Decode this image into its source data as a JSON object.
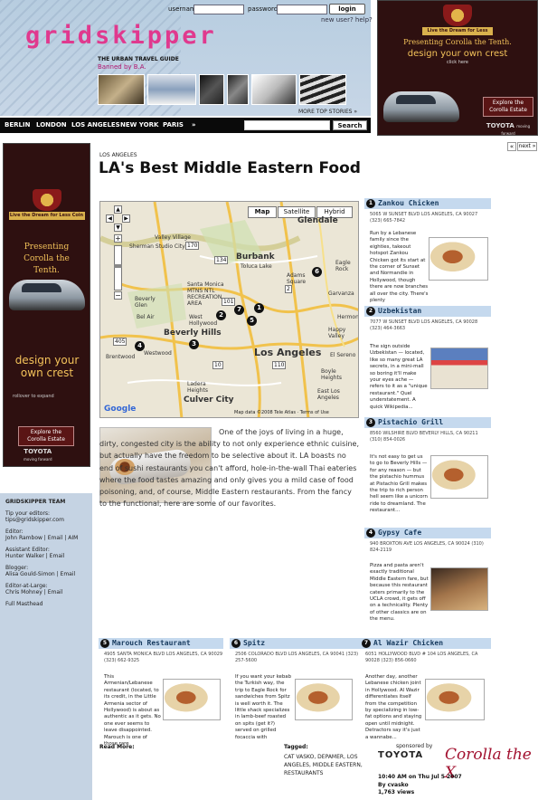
{
  "header": {
    "logo": "gridskipper",
    "username_label": "username:",
    "password_label": "password:",
    "login_button": "login",
    "new_user": "new user? help?",
    "tagline": "THE URBAN TRAVEL GUIDE",
    "banned": "Banned by B.A.",
    "more_stories": "MORE TOP STORIES »"
  },
  "nav": {
    "items": [
      "BERLIN",
      "LONDON",
      "LOS ANGELES",
      "NEW YORK",
      "PARIS",
      "»"
    ],
    "search_button": "Search"
  },
  "ad_top": {
    "ribbon": "Live the Dream for Less Coin",
    "line1": "Presenting Corolla the Tenth.",
    "line2": "design your own crest",
    "link": "click here",
    "button": "Explore the Corolla Estate",
    "brand": "TOYOTA",
    "brand_sub": "moving forward"
  },
  "ad_left": {
    "ribbon": "Live the Dream for Less Coin",
    "line1": "Presenting Corolla the Tenth.",
    "line2": "design your own crest",
    "link": "rollover to expand",
    "button": "Explore the Corolla Estate",
    "brand": "TOYOTA",
    "brand_sub": "moving forward"
  },
  "sidebar": {
    "heading": "GRIDSKIPPER TEAM",
    "tip_label": "Tip your editors:",
    "tip_email": "tips@gridskipper.com",
    "editor_label": "Editor:",
    "editor": "John Rambow | Email | AIM",
    "asst_label": "Assistant Editor:",
    "asst": "Hunter Walker | Email",
    "blogger_label": "Blogger:",
    "blogger": "Alisa Gould-Simon | Email",
    "large_label": "Editor-at-Large:",
    "large": "Chris Mohney | Email",
    "masthead": "Full Masthead"
  },
  "pager": {
    "prev": "«",
    "next": "next »"
  },
  "article": {
    "kicker": "LOS ANGELES",
    "title": "LA's Best Middle Eastern Food",
    "intro": "One of the joys of living in a huge, dirty, congested city is the ability to not only experience ethnic cuisine, but actually have the freedom to be selective about it. LA boasts no end of sushi restaurants you can't afford, hole-in-the-wall Thai eateries where the food tastes amazing and only gives you a mild case of food poisoning, and, of course, Middle Eastern restaurants. From the fancy to the functional, here are some of our favorites.",
    "read_more": "Read More:",
    "tagged_label": "Tagged:",
    "tags": "CAT VASKO, DEPAMER, LOS ANGELES, MIDDLE EASTERN, RESTAURANTS",
    "sponsored": "sponsored by",
    "sponsor_brand": "TOYOTA",
    "sponsor_product": "Corolla the X",
    "posted_time": "10:40 AM on Thu Jul 5 2007",
    "posted_by": "By cvasko",
    "views": "1,763 views"
  },
  "map": {
    "types": [
      "Map",
      "Satellite",
      "Hybrid"
    ],
    "cities": [
      "Glendale",
      "Burbank",
      "Toluca Lake",
      "Sherman Studio City",
      "Valley Village",
      "Santa Monica MTNS NTL RECREATION AREA",
      "Beverly Glen",
      "Bel Air",
      "West Hollywood",
      "Beverly Hills",
      "Brentwood",
      "Westwood",
      "Los Angeles",
      "Ladera Heights",
      "Culver City",
      "Eagle Rock",
      "Garvanza",
      "Adams Square",
      "Happy Valley",
      "Hermon",
      "El Sereno",
      "Boyle Heights",
      "East Los Angeles"
    ],
    "highways": [
      "170",
      "134",
      "101",
      "405",
      "10",
      "110",
      "2"
    ],
    "markers": [
      "1",
      "2",
      "3",
      "4",
      "5",
      "6",
      "7"
    ],
    "copyright": "Map data ©2008 Tele Atlas · Terms of Use",
    "google": "Google"
  },
  "restaurants": [
    {
      "n": "1",
      "name": "Zankou Chicken",
      "addr": "5065 W SUNSET BLVD LOS ANGELES, CA 90027 (323) 665-7842",
      "desc": "Run by a Lebanese family since the eighties, takeout hotspot Zankou Chicken got its start at the corner of Sunset and Normandie in Hollywood, though there are now branches all over the city. There's plenty"
    },
    {
      "n": "2",
      "name": "Uzbekistan",
      "addr": "7077 W SUNSET BLVD LOS ANGELES, CA 90028 (323) 464-3663",
      "desc": "The sign outside Uzbekistan — located, like so many great LA secrets, in a mini-mall so boring it'll make your eyes ache — refers to it as a \"unique restaurant.\" Quel understatement. A quick Wikipedia..."
    },
    {
      "n": "3",
      "name": "Pistachio Grill",
      "addr": "8560 WILSHIRE BLVD BEVERLY HILLS, CA 90211 (310) 854-0026",
      "desc": "It's not easy to get us to go to Beverly Hills — for any reason — but the pistachio hummus at Pistachio Grill makes the trip to rich person hell seem like a unicorn ride to dreamland. The restaurant..."
    },
    {
      "n": "4",
      "name": "Gypsy Cafe",
      "addr": "940 BROXTON AVE LOS ANGELES, CA 90024 (310) 824-2119",
      "desc": "Pizza and pasta aren't exactly traditional Middle Eastern fare, but because this restaurant caters primarily to the UCLA crowd, it gets off on a technicality. Plenty of other classics are on the menu."
    },
    {
      "n": "5",
      "name": "Marouch Restaurant",
      "addr": "4905 SANTA MONICA BLVD LOS ANGELES, CA 90029 (323) 662-9325",
      "desc": "This Armenian/Lebanese restaurant (located, to its credit, in the Little Armenia sector of Hollywood) is about as authentic as it gets. No one ever seems to leave disappointed. Marouch is one of those rare"
    },
    {
      "n": "6",
      "name": "Spitz",
      "addr": "2506 COLORADO BLVD LOS ANGELES, CA 90041 (323) 257-5600",
      "desc": "If you want your kebab the Turkish way, the trip to Eagle Rock for sandwiches from Spitz is well worth it. The little shack specializes in lamb-beef roasted on spits (get it?) served on grilled focaccia with"
    },
    {
      "n": "7",
      "name": "Al Wazir Chicken",
      "addr": "6051 HOLLYWOOD BLVD # 104 LOS ANGELES, CA 90028 (323) 856-0660",
      "desc": "Another day, another Lebanese chicken joint in Hollywood. Al Wazir differentiates itself from the competition by specializing in low-fat options and staying open until midnight. Detractors say it's just a wannabe..."
    }
  ]
}
